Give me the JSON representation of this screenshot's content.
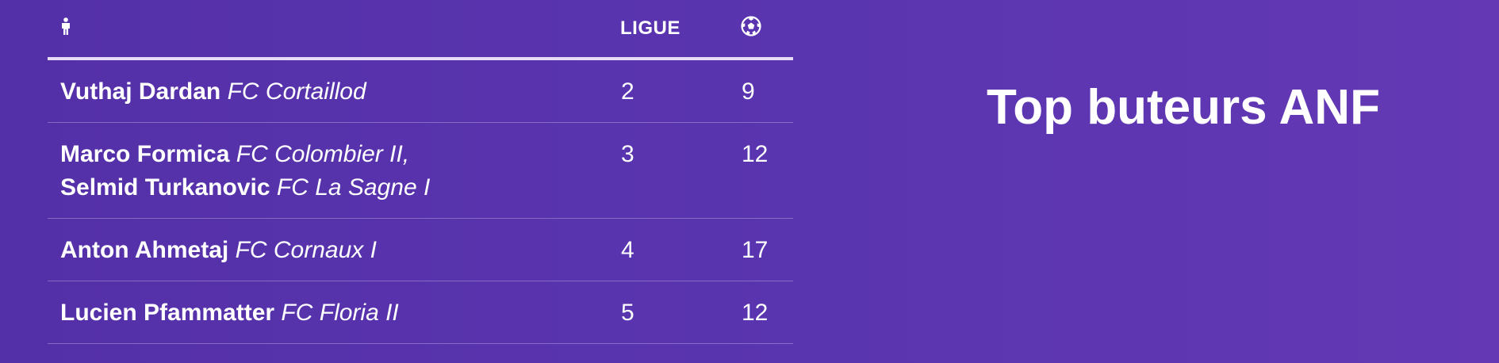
{
  "title": "Top buteurs ANF",
  "table": {
    "headers": {
      "player_icon": "person-icon",
      "league": "LIGUE",
      "goals_icon": "soccer-ball-icon"
    },
    "rows": [
      {
        "players": [
          {
            "name": "Vuthaj Dardan",
            "club": "FC Cortaillod"
          }
        ],
        "league": "2",
        "goals": "9"
      },
      {
        "players": [
          {
            "name": "Marco Formica",
            "club": "FC Colombier II,"
          },
          {
            "name": "Selmid Turkanovic",
            "club": "FC La Sagne I"
          }
        ],
        "league": "3",
        "goals": "12"
      },
      {
        "players": [
          {
            "name": "Anton Ahmetaj",
            "club": "FC Cornaux I"
          }
        ],
        "league": "4",
        "goals": "17"
      },
      {
        "players": [
          {
            "name": "Lucien Pfammatter",
            "club": "FC Floria II"
          }
        ],
        "league": "5",
        "goals": "12"
      }
    ]
  }
}
